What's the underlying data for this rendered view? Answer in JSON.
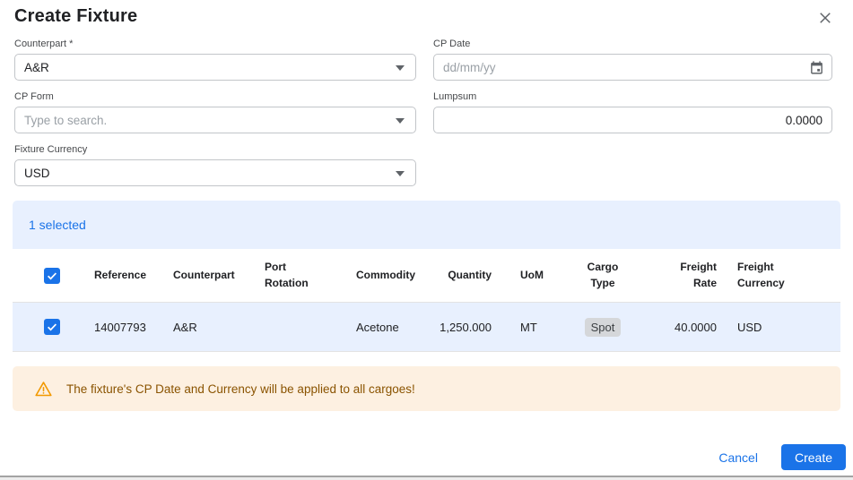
{
  "dialog": {
    "title": "Create Fixture"
  },
  "form": {
    "counterpart": {
      "label": "Counterpart *",
      "value": "A&R"
    },
    "cp_date": {
      "label": "CP Date",
      "placeholder": "dd/mm/yy"
    },
    "cp_form": {
      "label": "CP Form",
      "placeholder": "Type to search."
    },
    "lumpsum": {
      "label": "Lumpsum",
      "value": "0.0000"
    },
    "fixture_currency": {
      "label": "Fixture Currency",
      "value": "USD"
    }
  },
  "selection": {
    "summary": "1 selected"
  },
  "table": {
    "columns": [
      "Reference",
      "Counterpart",
      "Port Rotation",
      "Commodity",
      "Quantity",
      "UoM",
      "Cargo Type",
      "Freight Rate",
      "Freight Currency"
    ],
    "rows": [
      {
        "selected": true,
        "reference": "14007793",
        "counterpart": "A&R",
        "port_rotation": "",
        "commodity": "Acetone",
        "quantity": "1,250.000",
        "uom": "MT",
        "cargo_type": "Spot",
        "freight_rate": "40.0000",
        "freight_currency": "USD"
      }
    ]
  },
  "warning": {
    "message": "The fixture's CP Date and Currency will be applied to all cargoes!"
  },
  "footer": {
    "cancel_label": "Cancel",
    "create_label": "Create"
  },
  "colors": {
    "accent_blue": "#1a73e8",
    "selected_bg": "#e8f0fe",
    "warning_bg": "#fdf0e1",
    "warning_text": "#8a5300",
    "warning_icon": "#f29900",
    "badge_bg": "#d5d7da"
  }
}
